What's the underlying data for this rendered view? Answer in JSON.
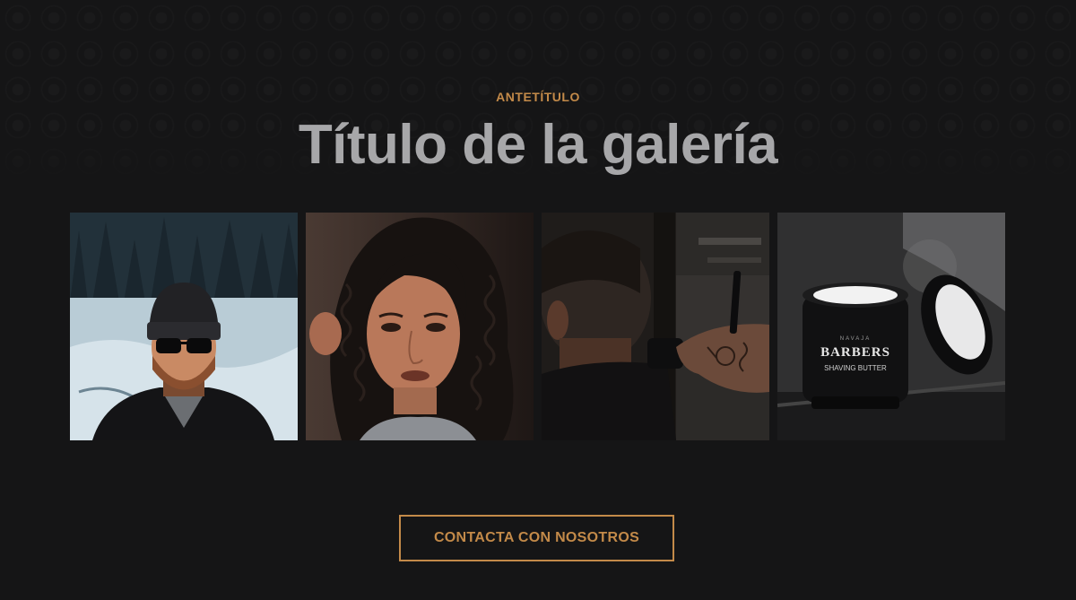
{
  "section": {
    "eyebrow": "ANTETÍTULO",
    "title": "Título de la galería"
  },
  "gallery": {
    "images": [
      {
        "subject": "man-beanie-sunglasses-snow"
      },
      {
        "subject": "woman-curly-hair"
      },
      {
        "subject": "barber-cutting-hair"
      },
      {
        "subject": "shaving-butter-jar",
        "brand_small": "NAVAJA",
        "brand": "BARBERS",
        "product": "SHAVING BUTTER"
      }
    ]
  },
  "cta": {
    "label": "CONTACTA CON NOSOTROS"
  },
  "colors": {
    "background": "#151516",
    "accent": "#c38a49",
    "title": "#a7a7a9"
  }
}
